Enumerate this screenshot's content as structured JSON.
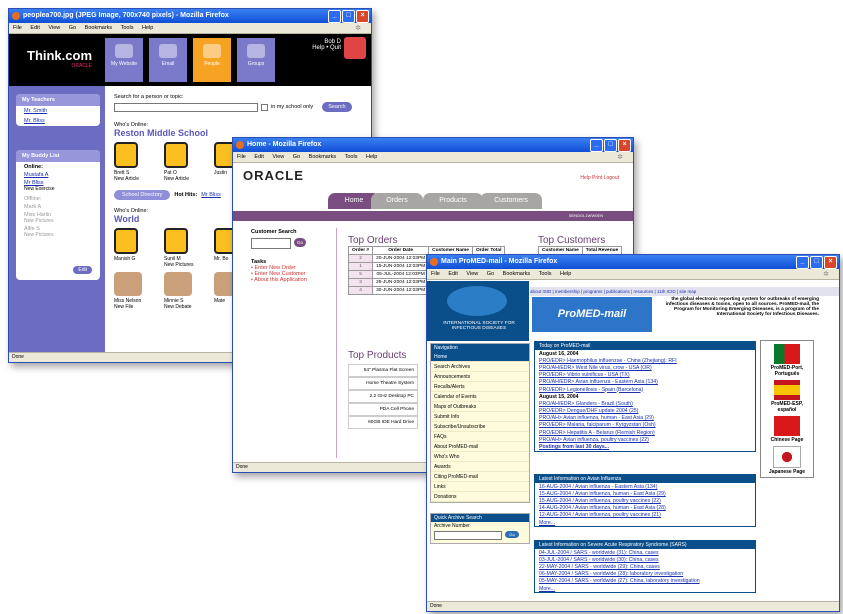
{
  "w1": {
    "title": "peoplea700.jpg (JPEG Image, 700x740 pixels) - Mozilla Firefox",
    "menu": [
      "File",
      "Edit",
      "View",
      "Go",
      "Bookmarks",
      "Tools",
      "Help"
    ],
    "logo": "Think.com",
    "logo_sub": "ORACLE",
    "nav_tiles": [
      "My Website",
      "Email",
      "People",
      "Groups"
    ],
    "user_name": "Bob D",
    "user_links": "Help • Quit",
    "teachers_header": "My Teachers",
    "teachers": [
      "Mr. Smith",
      "Mr. Bliss"
    ],
    "buddy_header": "My Buddy List",
    "online_label": "Online:",
    "buddies_online": [
      {
        "name": "Mustafa A",
        "note": ""
      },
      {
        "name": "Mr Bliss",
        "note": "New Exercise"
      }
    ],
    "offline_label": "Offline:",
    "buddies_offline": [
      {
        "name": "Mark A",
        "note": ""
      },
      {
        "name": "Miss Harlin",
        "note": "New Pictures"
      },
      {
        "name": "Alfie S",
        "note": "New Pictures"
      }
    ],
    "edit_label": "Edit",
    "search_label": "Search for a person or topic:",
    "school_only_label": "in my school only",
    "search_button": "Search",
    "whos_online_1": "Who's Online:",
    "school_heading": "Reston Middle School",
    "school_people": [
      {
        "name": "Brett S",
        "note": "New Article"
      },
      {
        "name": "Pat O",
        "note": "New Article"
      },
      {
        "name": "Justin",
        "note": ""
      }
    ],
    "dir_button": "School Directory",
    "hot_hits_label": "Hot Hits:",
    "hot_hit": "Mr Bliss",
    "whos_online_2": "Who's Online:",
    "world_heading": "World",
    "world_people": [
      {
        "name": "Manish G",
        "note": ""
      },
      {
        "name": "Sunil M",
        "note": "New Pictures"
      },
      {
        "name": "Mr. Bo",
        "note": ""
      }
    ],
    "world_people_2": [
      {
        "name": "Miss Nelson",
        "note": "New File"
      },
      {
        "name": "Minnie S",
        "note": "New Debate"
      },
      {
        "name": "Mate",
        "note": ""
      }
    ],
    "status": "Done"
  },
  "w2": {
    "title": "Home - Mozilla Firefox",
    "menu": [
      "File",
      "Edit",
      "View",
      "Go",
      "Bookmarks",
      "Tools",
      "Help"
    ],
    "logo": "ORACLE",
    "help_links": "Help Print Logout",
    "tabs": [
      "Home",
      "Orders",
      "Products",
      "Customers"
    ],
    "bar_text": "SENGGL1WW0EN",
    "customer_search_label": "Customer Search",
    "go_label": "Go",
    "tasks_label": "Tasks",
    "tasks": [
      "Enter New Order",
      "Enter New Customer",
      "About this Application"
    ],
    "top_orders_heading": "Top Orders",
    "orders_cols": [
      "Order #",
      "Order Date",
      "Customer Name",
      "Order Total"
    ],
    "orders": [
      [
        "2",
        "20-JUN-2004 12:03PM"
      ],
      [
        "1",
        "15-JUN-2004 12:03PM"
      ],
      [
        "5",
        "05-JUL-2004 12:03PM"
      ],
      [
        "3",
        "25-JUN-2004 12:03PM"
      ],
      [
        "4",
        "30-JUN-2004 12:03PM"
      ]
    ],
    "top_customers_heading": "Top Customers",
    "customers_cols": [
      "Customer Name",
      "Total Revenue"
    ],
    "top_products_heading": "Top Products",
    "products": [
      "54\" Plasma Flat Screen",
      "Home Theatre System",
      "2.2 GHz Desktop PC",
      "PDA Cell Phone",
      "60GB IDE Hard Drive"
    ],
    "status": "Done"
  },
  "w3": {
    "title": "Main ProMED-mail - Mozilla Firefox",
    "menu": [
      "File",
      "Edit",
      "View",
      "Go",
      "Bookmarks",
      "Tools",
      "Help"
    ],
    "top_links": "about ISID | membership | programs | publications | resources | 11th ICID | site map",
    "isid_name": "INTERNATIONAL SOCIETY FOR INFECTIOUS DISEASES",
    "banner": "ProMED-mail",
    "tagline": "the global electronic reporting system for outbreaks of emerging infectious diseases & toxins, open to all sources. ProMED-mail, the Program for Monitoring Emerging Diseases, is a program of the International Society for Infectious Diseases.",
    "nav_header": "Navigation",
    "nav_items": [
      "Home",
      "Search Archives",
      "Announcements",
      "Recalls/Alerts",
      "Calendar of Events",
      "Maps of Outbreaks",
      "Submit Info",
      "Subscribe/Unsubscribe",
      "FAQs",
      "About ProMED-mail",
      "Who's Who",
      "Awards",
      "Citing ProMED-mail",
      "Links",
      "Donations"
    ],
    "qa_header": "Quick Archive Search",
    "qa_label": "Archive Number",
    "today_header": "Today on ProMED-mail",
    "today_date1": "August 16, 2004",
    "today_items1": [
      "PRO/EDR> Haemophilus influenzae - China (Zhejiang): RFI",
      "PRO/AH/EDR> West Nile virus, crow - USA (OR)",
      "PRO/EDR> Vibrio vulnificus - USA (TX)",
      "PRO/AH/EDR> Avian influenza - Eastern Asia (134)",
      "PRO/EDR> Legionellosis - Spain (Barcelona)"
    ],
    "today_date2": "August 15, 2004",
    "today_items2": [
      "PRO/AH/EDR> Glanders - Brazil (South)",
      "PRO/EDR> Dengue/DHF update 2004 (25)",
      "PRO/AH> Avian influenza, human - East Asia (29)",
      "PRO/EDR> Malaria, falciparum - Kyrgyzstan (Osh)",
      "PRO/EDR> Hepatitis A - Belarus (Flemish Region)",
      "PRO/AH> Avian influenza, poultry vaccines (22)"
    ],
    "today_more": "Postings from last 30 days...",
    "avian_header": "Latest Information on Avian Influenza",
    "avian_items": [
      "16-AUG-2004 / Avian influenza - Eastern Asia (134)",
      "15-AUG-2004 / Avian influenza, human - East Asia (29)",
      "15-AUG-2004 / Avian influenza, poultry vaccines (22)",
      "14-AUG-2004 / Avian influenza, human - East Asia (28)",
      "12-AUG-2004 / Avian influenza, poultry vaccines (21)"
    ],
    "avian_more": "More...",
    "sars_header": "Latest Information on Severe Acute Respiratory Syndrome (SARS)",
    "sars_items": [
      "04-JUL-2004 / SARS - worldwide (31): China, cases",
      "03-JUL-2004 / SARS - worldwide (30): China, cases",
      "22-MAY-2004 / SARS - worldwide (29): China, cases",
      "06-MAY-2004 / SARS - worldwide (28): laboratory investigation",
      "05-MAY-2004 / SARS - worldwide (27): China, laboratory investigation"
    ],
    "sars_more": "More...",
    "flags": [
      {
        "label": "ProMED-Port, Português",
        "icon": "portugal-flag"
      },
      {
        "label": "ProMED-ESP, español",
        "icon": "spain-flag"
      },
      {
        "label": "Chinese Page",
        "icon": "china-flag"
      },
      {
        "label": "Japanese Page",
        "icon": "japan-flag"
      }
    ],
    "status": "Done"
  }
}
